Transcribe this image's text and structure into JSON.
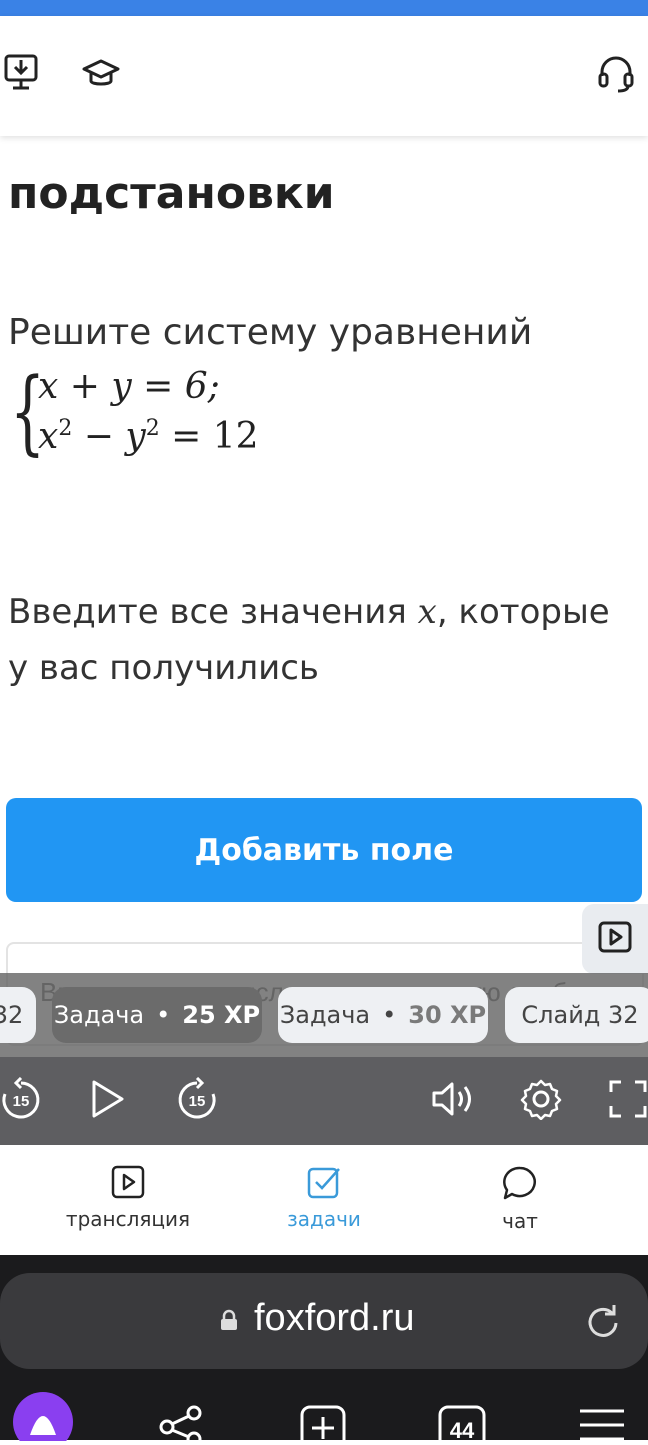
{
  "header": {
    "download_icon": "monitor-download-icon",
    "course_icon": "graduation-cap-icon",
    "support_icon": "headset-icon"
  },
  "lesson": {
    "title": "подстановки",
    "task_text": "Решите систему уравнений",
    "equation1": "x + y = 6;",
    "equation2_a": "x",
    "equation2_b": "2",
    "equation2_c": " − y",
    "equation2_d": "2",
    "equation2_e": " = 12",
    "prompt_before": "Введите все значения ",
    "prompt_var": "x",
    "prompt_after": ", которые у вас получились",
    "add_field_label": "Добавить поле",
    "input_placeholder": "Введите целое число или десятичную дробь"
  },
  "slides": [
    {
      "label": "32"
    },
    {
      "label": "Задача",
      "xp": "25 XP"
    },
    {
      "label": "Задача",
      "xp": "30 XP"
    },
    {
      "label": "Слайд 32"
    }
  ],
  "player": {
    "rewind_label": "15",
    "forward_label": "15"
  },
  "bottom_nav": [
    {
      "label": "трансляция",
      "icon": "play-square-icon"
    },
    {
      "label": "задачи",
      "icon": "checkbox-icon"
    },
    {
      "label": "чат",
      "icon": "chat-bubble-icon"
    }
  ],
  "browser": {
    "url": "foxford.ru",
    "tabs_count": "44"
  },
  "colors": {
    "accent": "#2196f3",
    "topbar": "#3a82e6",
    "nav_active": "#3a9ad9"
  }
}
